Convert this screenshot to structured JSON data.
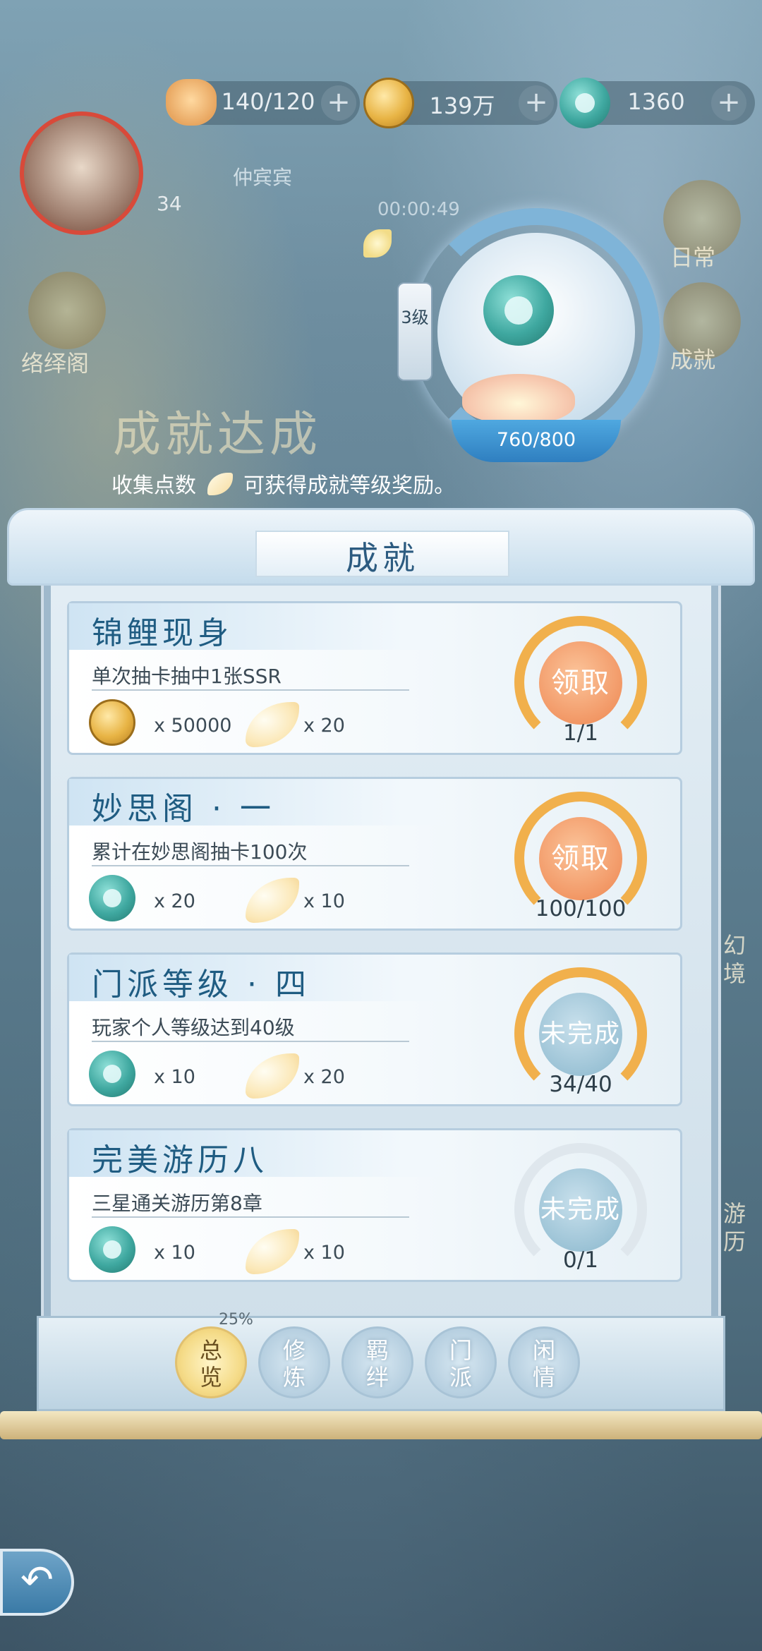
{
  "top_resources": [
    {
      "icon": "cat-stamina-icon",
      "value": "140/120"
    },
    {
      "icon": "gold-coin-icon",
      "value": "139万"
    },
    {
      "icon": "jade-icon",
      "value": "1360"
    }
  ],
  "player": {
    "name": "仲宾宾",
    "level": "34",
    "timer": "00:00:49"
  },
  "side_labels": {
    "left_top": "络绎阁",
    "right_top": "日常",
    "right_mid": "成就",
    "right_low": "幻境",
    "right_bottom": "游历"
  },
  "banner": {
    "title": "成就达成"
  },
  "header": {
    "level_tag": "3级",
    "progress": "760/800",
    "progress_value": 760,
    "progress_max": 800,
    "hint_before": "收集点数",
    "hint_after": "可获得成就等级奖励。"
  },
  "panel_title": "成就",
  "achievements": [
    {
      "name": "锦鲤现身",
      "desc": "单次抽卡抽中1张SSR",
      "reward1_icon": "gold-coin-icon",
      "reward1_qty": "x 50000",
      "reward2_icon": "petal-icon",
      "reward2_qty": "x 20",
      "button": "领取",
      "state": "claim",
      "progress": "1/1"
    },
    {
      "name": "妙思阁 · 一",
      "desc": "累计在妙思阁抽卡100次",
      "reward1_icon": "jade-icon",
      "reward1_qty": "x 20",
      "reward2_icon": "petal-icon",
      "reward2_qty": "x 10",
      "button": "领取",
      "state": "claim",
      "progress": "100/100"
    },
    {
      "name": "门派等级 · 四",
      "desc": "玩家个人等级达到40级",
      "reward1_icon": "jade-icon",
      "reward1_qty": "x 10",
      "reward2_icon": "petal-icon",
      "reward2_qty": "x 20",
      "button": "未完成",
      "state": "incomplete",
      "progress": "34/40"
    },
    {
      "name": "完美游历八",
      "desc": "三星通关游历第8章",
      "reward1_icon": "jade-icon",
      "reward1_qty": "x 10",
      "reward2_icon": "petal-icon",
      "reward2_qty": "x 10",
      "button": "未完成",
      "state": "incomplete",
      "progress": "0/1"
    }
  ],
  "tabs_percent": "25%",
  "tabs": [
    {
      "l1": "总",
      "l2": "览",
      "active": true
    },
    {
      "l1": "修",
      "l2": "炼",
      "active": false
    },
    {
      "l1": "羁",
      "l2": "绊",
      "active": false
    },
    {
      "l1": "门",
      "l2": "派",
      "active": false
    },
    {
      "l1": "闲",
      "l2": "情",
      "active": false
    }
  ],
  "colors": {
    "claim_orange": "#f29866",
    "ring_orange": "#f1b04c",
    "incomplete_blue": "#9cc3d6",
    "title_blue": "#1f5c82"
  }
}
